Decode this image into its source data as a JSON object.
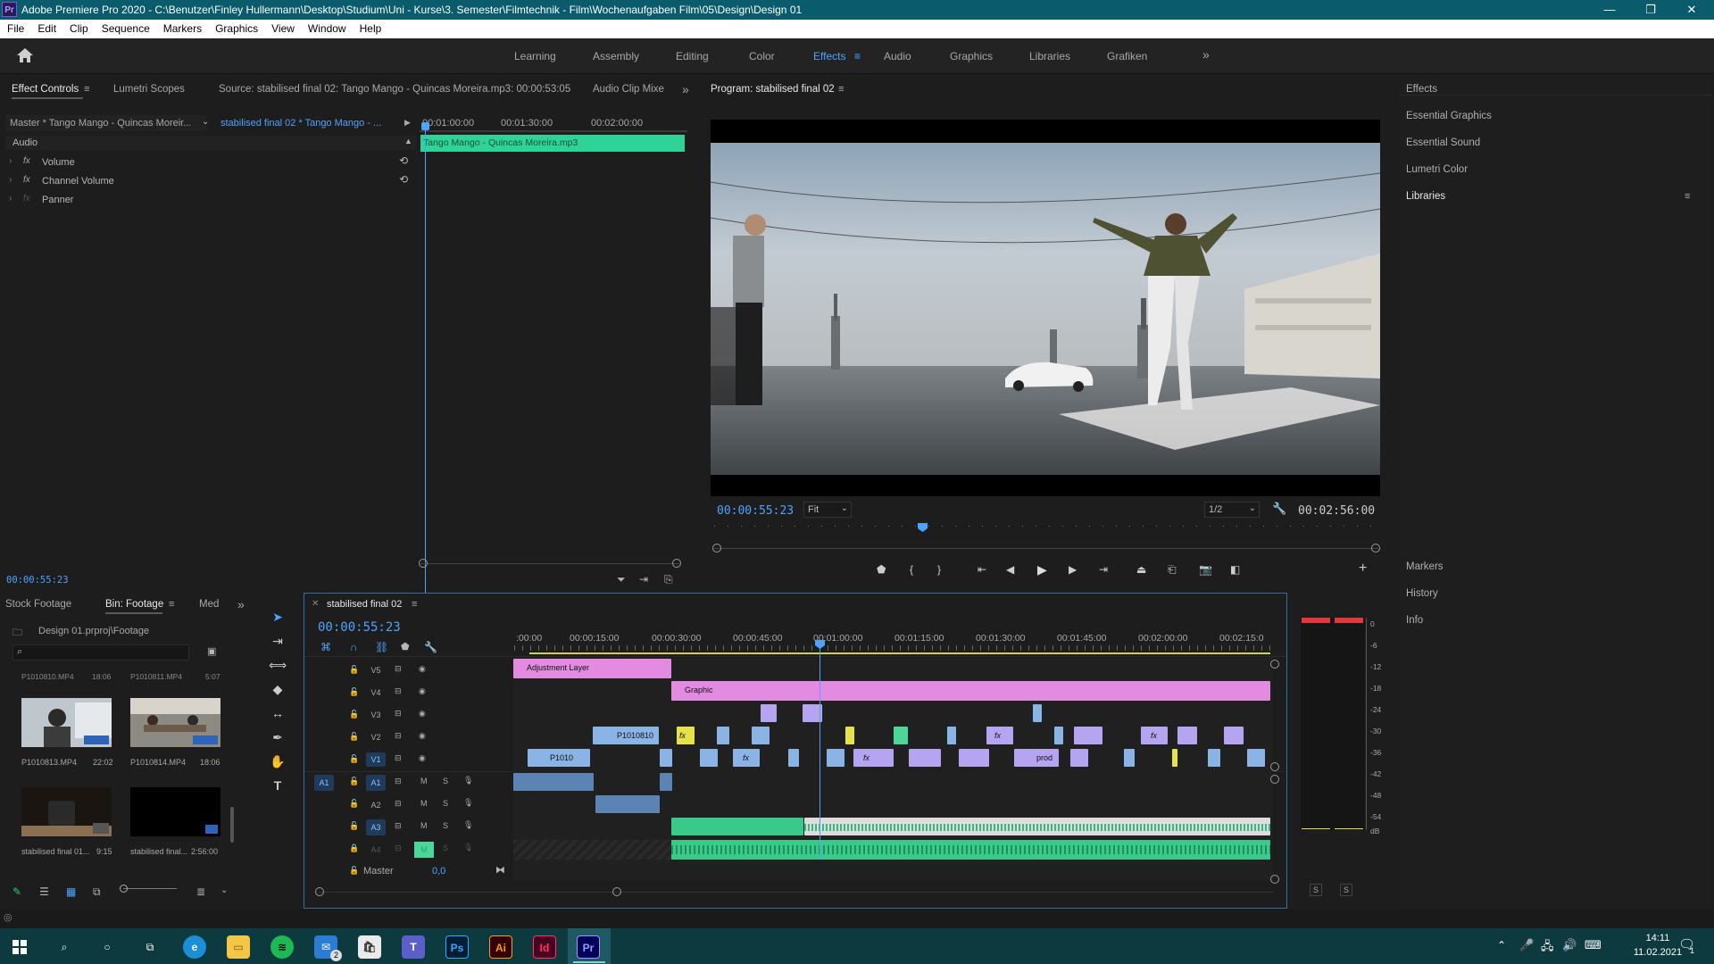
{
  "window": {
    "title": "Adobe Premiere Pro 2020 - C:\\Benutzer\\Finley Hullermann\\Desktop\\Studium\\Uni - Kurse\\3. Semester\\Filmtechnik - Film\\Wochenaufgaben Film\\05\\Design\\Design 01",
    "app_badge": "Pr",
    "minimize": "—",
    "restore": "❐",
    "close": "✕"
  },
  "menu": [
    "File",
    "Edit",
    "Clip",
    "Sequence",
    "Markers",
    "Graphics",
    "View",
    "Window",
    "Help"
  ],
  "workspaces": {
    "tabs": [
      "Learning",
      "Assembly",
      "Editing",
      "Color",
      "Effects",
      "Audio",
      "Graphics",
      "Libraries",
      "Grafiken"
    ],
    "active": "Effects",
    "more": "»",
    "menu_glyph": "≡"
  },
  "source_panel": {
    "tabs": [
      "Effect Controls",
      "Lumetri Scopes",
      "Source: stabilised final 02: Tango Mango - Quincas Moreira.mp3: 00:00:53:05",
      "Audio Clip Mixe"
    ],
    "more": "»",
    "master_label": "Master * Tango Mango - Quincas Moreir...",
    "sequence_clip": "stabilised final 02 * Tango Mango - ...",
    "ruler": [
      "00:01:00:00",
      "00:01:30:00",
      "00:02:00:00"
    ],
    "clip_name": "Tango Mango - Quincas Moreira.mp3",
    "section": "Audio",
    "effects": [
      "Volume",
      "Channel Volume",
      "Panner"
    ],
    "fx_glyph": "fx",
    "timecode": "00:00:55:23"
  },
  "program_monitor": {
    "title": "Program: stabilised final 02",
    "timecode": "00:00:55:23",
    "fit": "Fit",
    "resolution": "1/2",
    "duration": "00:02:56:00"
  },
  "right_panel": {
    "top_items": [
      "Effects",
      "Essential Graphics",
      "Essential Sound",
      "Lumetri Color",
      "Libraries"
    ],
    "bottom_items": [
      "Markers",
      "History",
      "Info"
    ]
  },
  "project_panel": {
    "tabs": [
      "Stock Footage",
      "Bin: Footage",
      "Med"
    ],
    "path": "Design 01.prproj\\Footage",
    "search_placeholder": "",
    "top_row": [
      {
        "name": "P1010810.MP4",
        "dur": "18:06"
      },
      {
        "name": "P1010811.MP4",
        "dur": "5:07"
      }
    ],
    "items": [
      {
        "name": "P1010813.MP4",
        "dur": "22:02"
      },
      {
        "name": "P1010814.MP4",
        "dur": "18:06"
      },
      {
        "name": "stabilised final 01...",
        "dur": "9:15"
      },
      {
        "name": "stabilised final...",
        "dur": "2:56:00"
      }
    ]
  },
  "timeline": {
    "sequence_name": "stabilised final 02",
    "timecode": "00:00:55:23",
    "ruler": [
      ":00:00",
      "00:00:15:00",
      "00:00:30:00",
      "00:00:45:00",
      "00:01:00:00",
      "00:01:15:00",
      "00:01:30:00",
      "00:01:45:00",
      "00:02:00:00",
      "00:02:15:0"
    ],
    "video_tracks": [
      "V5",
      "V4",
      "V3",
      "V2",
      "V1"
    ],
    "audio_tracks": [
      "A1",
      "A2",
      "A3",
      "A4"
    ],
    "master_label": "Master",
    "master_value": "0,0",
    "source_patch": "A1",
    "mute": "M",
    "solo": "S",
    "clips": {
      "adjustment": "Adjustment Layer",
      "graphic": "Graphic",
      "v2_clip": "P1010810",
      "v1_clip": "P1010",
      "v1_prod": "prod",
      "fx": "fx"
    }
  },
  "audio_meter": {
    "scale": [
      "0",
      "-6",
      "-12",
      "-18",
      "-24",
      "-30",
      "-36",
      "-42",
      "-48",
      "-54",
      "dB"
    ],
    "solo_left": "S",
    "solo_right": "S"
  },
  "taskbar": {
    "time": "14:11",
    "date": "11.02.2021",
    "notification_count": "1",
    "mail_badge": "2"
  }
}
